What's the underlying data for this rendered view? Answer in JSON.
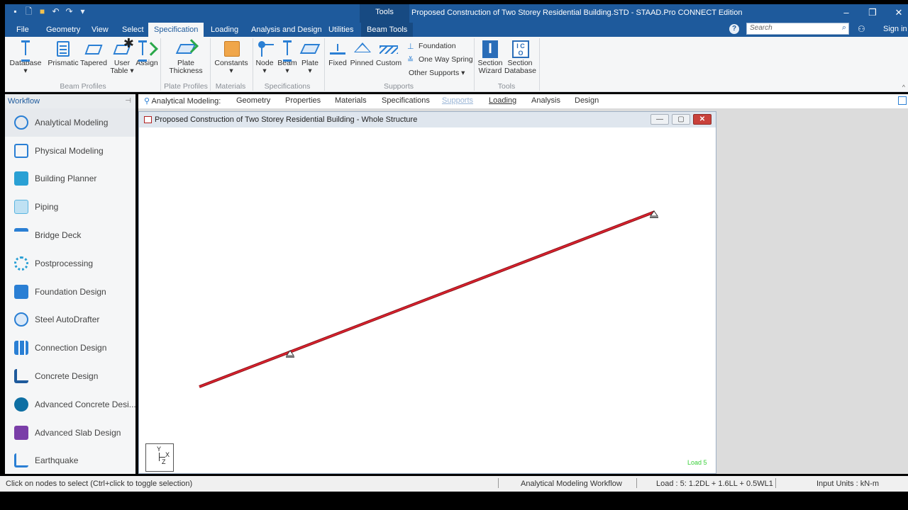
{
  "window": {
    "title": "Proposed Construction of Two Storey Residential Building.STD - STAAD.Pro CONNECT Edition",
    "context_tab": "Tools"
  },
  "tabs": [
    "File",
    "Geometry",
    "View",
    "Select",
    "Specification",
    "Loading",
    "Analysis and Design",
    "Utilities",
    "Beam Tools"
  ],
  "active_tab": "Specification",
  "search": {
    "placeholder": "Search"
  },
  "sign_in": "Sign in",
  "ribbon": {
    "beam_profiles": {
      "label": "Beam Profiles",
      "database": "Database",
      "prismatic": "Prismatic",
      "tapered": "Tapered",
      "user_table_1": "User",
      "user_table_2": "Table",
      "assign": "Assign"
    },
    "plate_profiles": {
      "label": "Plate Profiles",
      "plate_1": "Plate",
      "plate_2": "Thickness"
    },
    "materials": {
      "label": "Materials",
      "constants": "Constants"
    },
    "specifications": {
      "label": "Specifications",
      "node": "Node",
      "beam": "Beam",
      "plate": "Plate"
    },
    "supports": {
      "label": "Supports",
      "fixed": "Fixed",
      "pinned": "Pinned",
      "custom": "Custom",
      "foundation": "Foundation",
      "one_way_spring": "One Way Spring",
      "other_supports": "Other Supports"
    },
    "tools": {
      "label": "Tools",
      "section_wizard_1": "Section",
      "section_wizard_2": "Wizard",
      "section_database_1": "Section",
      "section_database_2": "Database"
    }
  },
  "workflow": {
    "header": "Workflow",
    "items": [
      {
        "label": "Analytical Modeling",
        "color": "#2a7fd4"
      },
      {
        "label": "Physical Modeling",
        "color": "#2a7fd4"
      },
      {
        "label": "Building Planner",
        "color": "#2aa0d4"
      },
      {
        "label": "Piping",
        "color": "#5ab4e0"
      },
      {
        "label": "Bridge Deck",
        "color": "#2a7fd4"
      },
      {
        "label": "Postprocessing",
        "color": "#2a9fd4"
      },
      {
        "label": "Foundation Design",
        "color": "#2a7fd4"
      },
      {
        "label": "Steel AutoDrafter",
        "color": "#2a7fd4"
      },
      {
        "label": "Connection Design",
        "color": "#2a7fd4"
      },
      {
        "label": "Concrete Design",
        "color": "#1e5a9c"
      },
      {
        "label": "Advanced Concrete Desi...",
        "color": "#0e6fa3"
      },
      {
        "label": "Advanced Slab Design",
        "color": "#7a3ea8"
      },
      {
        "label": "Earthquake",
        "color": "#2a7fd4"
      }
    ]
  },
  "subtoolbar": {
    "label": "Analytical Modeling:",
    "items": [
      "Geometry",
      "Properties",
      "Materials",
      "Specifications",
      "Supports",
      "Loading",
      "Analysis",
      "Design"
    ]
  },
  "document": {
    "title": "Proposed Construction of Two Storey Residential Building - Whole Structure",
    "load_label": "Load 5",
    "axis_y": "Y",
    "axis_x": "X",
    "axis_z": "Z"
  },
  "status": {
    "hint": "Click on nodes to select (Ctrl+click to toggle selection)",
    "workflow": "Analytical Modeling Workflow",
    "load": "Load : 5: 1.2DL + 1.6LL + 0.5WL1",
    "units": "Input Units : kN-m"
  },
  "colors": {
    "title_bar": "#1e5a9c",
    "beam": "#d0202a",
    "accent": "#2a7fd4"
  }
}
